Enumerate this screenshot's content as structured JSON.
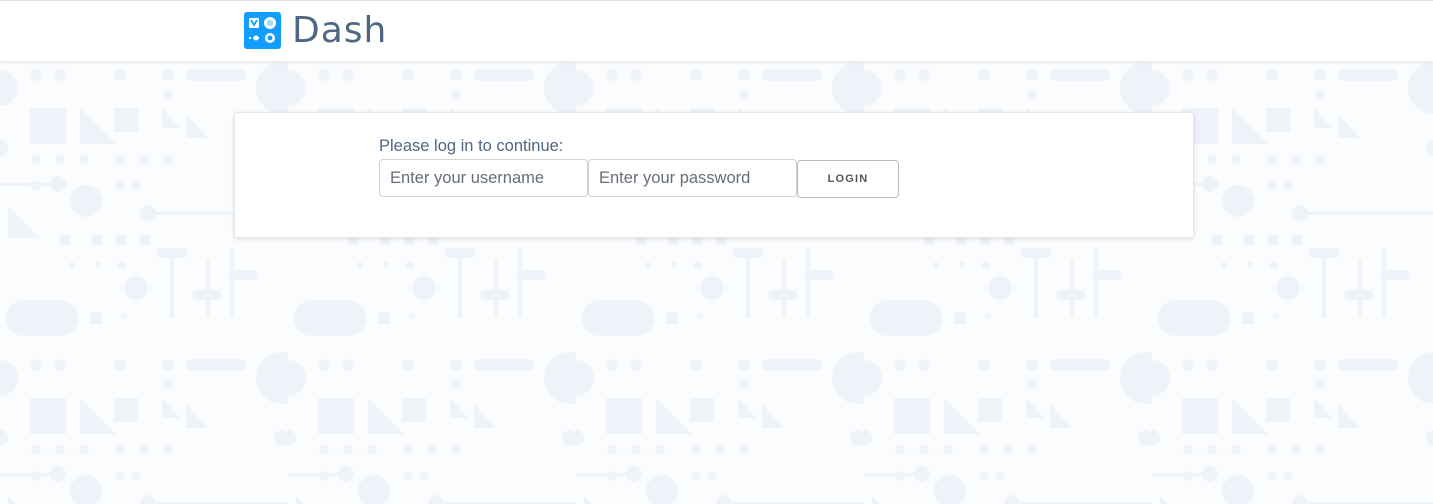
{
  "header": {
    "brand_name": "Dash",
    "logo_icon": "dash-logo-icon"
  },
  "login": {
    "prompt": "Please log in to continue:",
    "username_placeholder": "Enter your username",
    "username_value": "",
    "password_placeholder": "Enter your password",
    "password_value": "",
    "button_label": "LOGIN"
  },
  "colors": {
    "brand_blue": "#119dff",
    "text_slate": "#506784",
    "pattern": "#eef3f9",
    "background": "#fbfcfe"
  }
}
